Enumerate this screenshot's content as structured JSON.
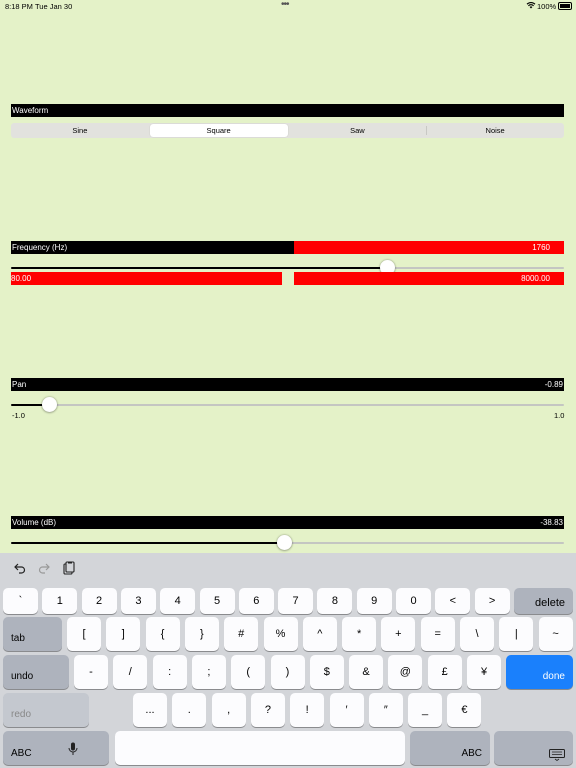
{
  "status_bar": {
    "time": "8:18 PM",
    "date": "Tue Jan 30",
    "battery": "100%"
  },
  "waveform": {
    "label": "Waveform",
    "options": [
      "Sine",
      "Square",
      "Saw",
      "Noise"
    ],
    "selected": "Square"
  },
  "frequency": {
    "label": "Frequency (Hz)",
    "value": "1760",
    "min": "80.00",
    "max": "8000.00",
    "slider_fraction": 0.68
  },
  "pan": {
    "label": "Pan",
    "value": "-0.89",
    "min": "-1.0",
    "max": "1.0",
    "slider_fraction": 0.07
  },
  "volume": {
    "label": "Volume (dB)",
    "value": "-38.83",
    "slider_fraction": 0.495
  },
  "keyboard": {
    "row1": [
      "`",
      "1",
      "2",
      "3",
      "4",
      "5",
      "6",
      "7",
      "8",
      "9",
      "0",
      "<",
      ">"
    ],
    "delete": "delete",
    "tab": "tab",
    "row2": [
      "[",
      "]",
      "{",
      "}",
      "#",
      "%",
      "^",
      "*",
      "+",
      "=",
      "\\",
      "|",
      "~"
    ],
    "undo": "undo",
    "row3": [
      "-",
      "/",
      ":",
      ";",
      "(",
      ")",
      "$",
      "&",
      "@",
      "£",
      "¥"
    ],
    "done": "done",
    "redo": "redo",
    "row4": [
      "...",
      ".",
      ",",
      "?",
      "!",
      "′",
      "″",
      "_",
      "€"
    ],
    "abc_left": "ABC",
    "abc_right": "ABC"
  },
  "icons": [
    "undo-icon",
    "redo-icon",
    "paste-icon",
    "mic-icon",
    "keyboard-dismiss-icon",
    "wifi-icon",
    "battery-icon"
  ]
}
